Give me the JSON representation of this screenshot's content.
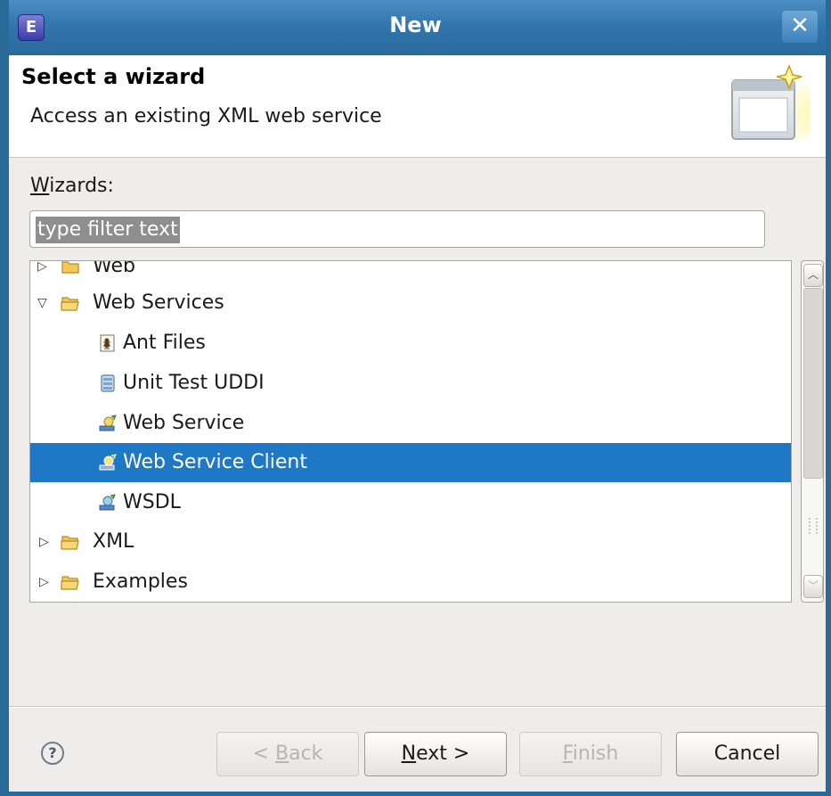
{
  "window": {
    "title": "New",
    "close_glyph": "✕",
    "app_icon_glyph": "E"
  },
  "banner": {
    "title": "Select a wizard",
    "description": "Access an existing XML web service"
  },
  "wizards_label": {
    "mnemonic": "W",
    "rest": "izards:"
  },
  "filter": {
    "value": "type filter text"
  },
  "tree": {
    "items": [
      {
        "label": "Web",
        "expanded": false,
        "icon": "folder-icon"
      },
      {
        "label": "Web Services",
        "expanded": true,
        "icon": "folder-open-icon"
      },
      {
        "label": "Ant Files",
        "icon": "ant-files-icon"
      },
      {
        "label": "Unit Test UDDI",
        "icon": "uddi-icon"
      },
      {
        "label": "Web Service",
        "icon": "web-service-icon"
      },
      {
        "label": "Web Service Client",
        "icon": "web-service-client-icon",
        "selected": true
      },
      {
        "label": "WSDL",
        "icon": "wsdl-icon"
      },
      {
        "label": "XML",
        "expanded": false,
        "icon": "folder-icon"
      },
      {
        "label": "Examples",
        "expanded": false,
        "icon": "folder-icon"
      }
    ]
  },
  "buttons": {
    "help": "?",
    "back": {
      "prefix": "< ",
      "mnemonic": "B",
      "rest": "ack"
    },
    "next": {
      "mnemonic": "N",
      "rest": "ext >"
    },
    "finish": {
      "mnemonic": "F",
      "rest": "inish"
    },
    "cancel": "Cancel"
  },
  "colors": {
    "titlebar": "#3276ad",
    "selection": "#1e78c5",
    "dialog_bg": "#eeedec"
  }
}
